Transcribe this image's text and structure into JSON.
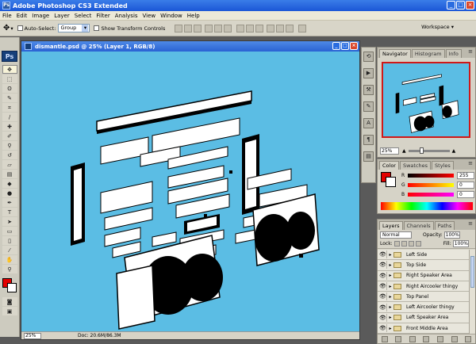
{
  "app": {
    "title": "Adobe Photoshop CS3 Extended",
    "logo": "Ps"
  },
  "menu": [
    "File",
    "Edit",
    "Image",
    "Layer",
    "Select",
    "Filter",
    "Analysis",
    "View",
    "Window",
    "Help"
  ],
  "options": {
    "auto_select_label": "Auto-Select:",
    "auto_select_value": "Group",
    "transform_label": "Show Transform Controls",
    "workspace_label": "Workspace ▾"
  },
  "document": {
    "title": "dismantle.psd @ 25% (Layer 1, RGB/8)",
    "zoom": "25%",
    "doc_info": "Doc: 20.6M/86.3M"
  },
  "navigator": {
    "tabs": [
      "Navigator",
      "Histogram",
      "Info"
    ],
    "zoom": "25%"
  },
  "color": {
    "tabs": [
      "Color",
      "Swatches",
      "Styles"
    ],
    "r": "255",
    "g": "0",
    "b": "0",
    "fg_color": "#e30000",
    "bg_color": "#ffffff"
  },
  "layers": {
    "tabs": [
      "Layers",
      "Channels",
      "Paths"
    ],
    "blend_mode": "Normal",
    "opacity_label": "Opacity:",
    "opacity_value": "100%",
    "lock_label": "Lock:",
    "fill_label": "Fill:",
    "fill_value": "100%",
    "items": [
      "Left Side",
      "Top Side",
      "Right Speaker Area",
      "Right Aircooler thingy",
      "Top Panel",
      "Left Aircooler thingy",
      "Left Speaker Area",
      "Front Middle Area"
    ]
  },
  "tools": [
    "move",
    "marquee",
    "lasso",
    "quick-select",
    "crop",
    "slice",
    "heal",
    "brush",
    "stamp",
    "history",
    "eraser",
    "gradient",
    "blur",
    "dodge",
    "pen",
    "type",
    "path-select",
    "shape",
    "notes",
    "eyedropper",
    "hand",
    "zoom"
  ],
  "colors": {
    "canvas": "#5bbde4",
    "accent": "#e30000",
    "titlebar": "#2a62d3"
  }
}
